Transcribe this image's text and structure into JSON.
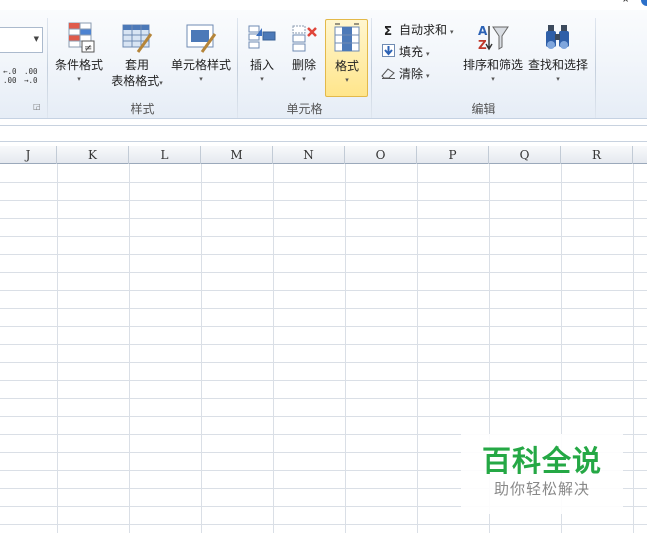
{
  "ribbon": {
    "number_group": {
      "increase_decimal": {
        "top": "←.0",
        "bottom": ".00"
      },
      "decrease_decimal": {
        "top": ".00",
        "bottom": "→.0"
      }
    },
    "styles_group": {
      "label": "样式",
      "conditional_format": "条件格式",
      "table_format_line1": "套用",
      "table_format_line2": "表格格式",
      "cell_styles": "单元格样式"
    },
    "cells_group": {
      "label": "单元格",
      "insert": "插入",
      "delete": "删除",
      "format": "格式"
    },
    "editing_group": {
      "label": "编辑",
      "autosum": "自动求和",
      "fill": "填充",
      "clear": "清除",
      "sort_filter": "排序和筛选",
      "find_select": "查找和选择"
    },
    "icons": {
      "sigma": "Σ",
      "caret": "▾"
    }
  },
  "sheet": {
    "columns": [
      "J",
      "K",
      "L",
      "M",
      "N",
      "O",
      "P",
      "Q",
      "R"
    ]
  },
  "watermark": {
    "title": "百科全说",
    "subtitle": "助你轻松解决"
  },
  "colors": {
    "accent_green": "#25a845",
    "format_highlight": "#ffe58b"
  }
}
